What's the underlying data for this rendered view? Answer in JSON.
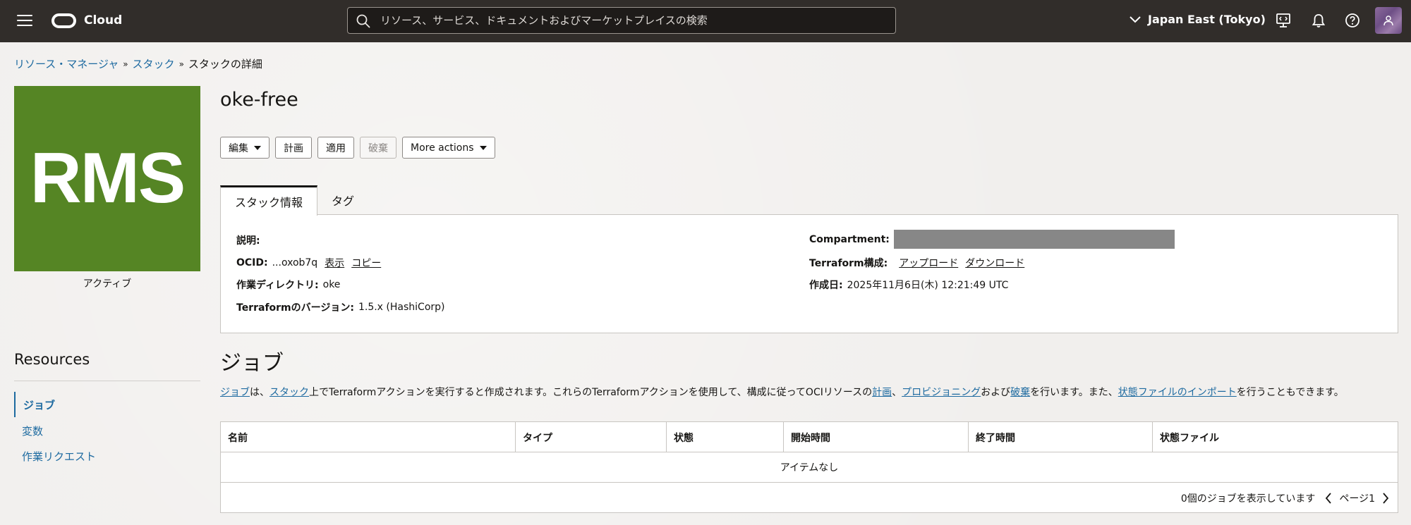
{
  "topbar": {
    "logo_text": "Cloud",
    "search_placeholder": "リソース、サービス、ドキュメントおよびマーケットプレイスの検索",
    "region": "Japan East (Tokyo)"
  },
  "breadcrumb": {
    "items": [
      "リソース・マネージャ",
      "スタック",
      "スタックの詳細"
    ]
  },
  "stack": {
    "tile_text": "RMS",
    "status": "アクティブ",
    "title": "oke-free"
  },
  "actions": {
    "edit": "編集",
    "plan": "計画",
    "apply": "適用",
    "destroy": "破棄",
    "more": "More actions"
  },
  "tabs": [
    "スタック情報",
    "タグ"
  ],
  "info": {
    "description_label": "説明:",
    "ocid_label": "OCID:",
    "ocid_value": "...oxob7q",
    "ocid_show": "表示",
    "ocid_copy": "コピー",
    "workdir_label": "作業ディレクトリ:",
    "workdir_value": "oke",
    "tfver_label": "Terraformのバージョン:",
    "tfver_value": "1.5.x (HashiCorp)",
    "compartment_label": "Compartment:",
    "tfconfig_label": "Terraform構成:",
    "tfconfig_upload": "アップロード",
    "tfconfig_download": "ダウンロード",
    "created_label": "作成日:",
    "created_value": "2025年11月6日(木) 12:21:49 UTC"
  },
  "resources": {
    "heading": "Resources",
    "items": [
      "ジョブ",
      "変数",
      "作業リクエスト"
    ]
  },
  "jobs": {
    "heading": "ジョブ",
    "desc": {
      "link1": "ジョブ",
      "t1": "は、",
      "link2": "スタック",
      "t2": "上でTerraformアクションを実行すると作成されます。これらのTerraformアクションを使用して、構成に従ってOCIリソースの",
      "link3": "計画",
      "t3": "、",
      "link4": "プロビジョニング",
      "t4": "および",
      "link5": "破棄",
      "t5": "を行います。また、",
      "link6": "状態ファイルのインポート",
      "t6": "を行うこともできます。"
    },
    "columns": [
      "名前",
      "タイプ",
      "状態",
      "開始時間",
      "終了時間",
      "状態ファイル"
    ],
    "empty": "アイテムなし",
    "count_text": "0個のジョブを表示しています",
    "page_text": "ページ1"
  }
}
